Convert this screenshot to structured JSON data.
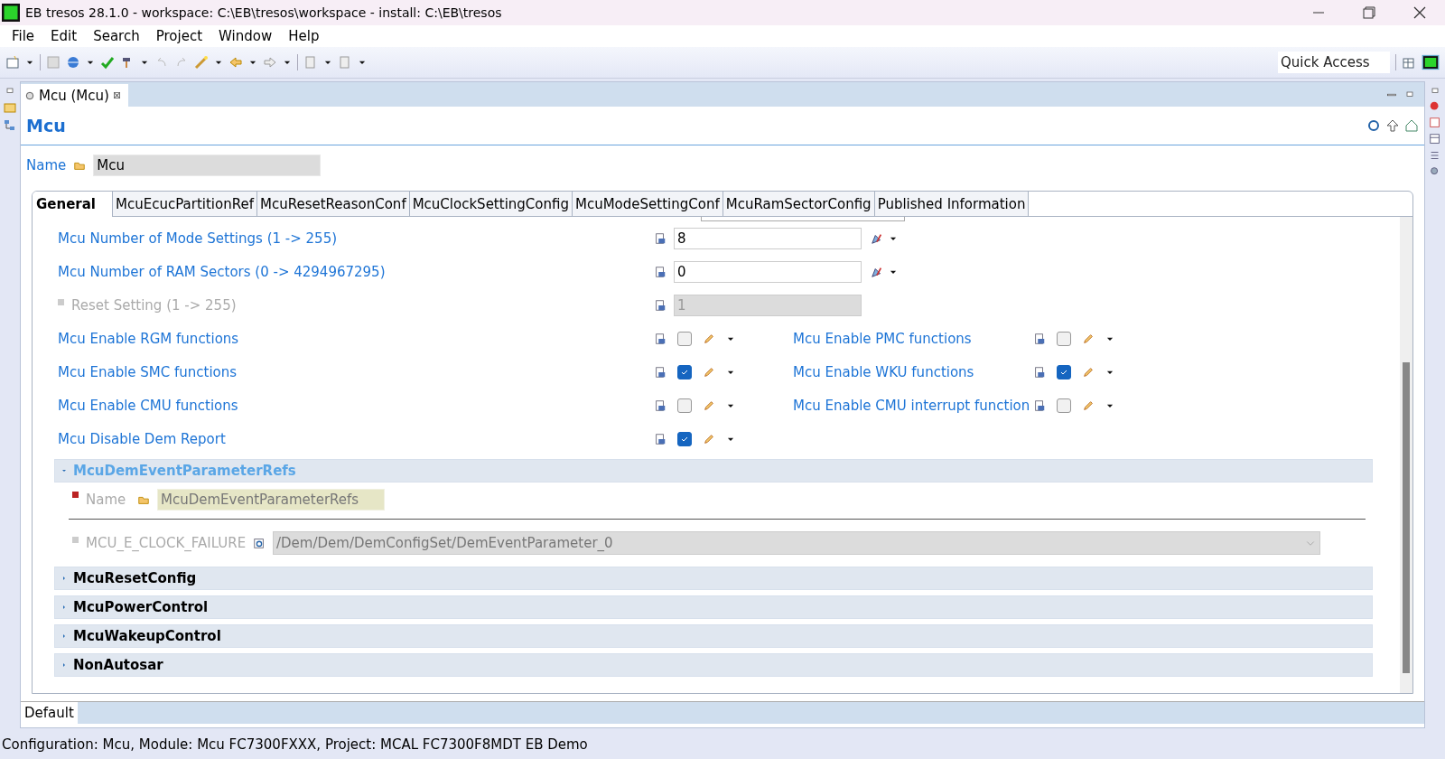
{
  "window": {
    "title": "EB tresos 28.1.0 - workspace: C:\\EB\\tresos\\workspace - install: C:\\EB\\tresos"
  },
  "menu": [
    "File",
    "Edit",
    "Search",
    "Project",
    "Window",
    "Help"
  ],
  "quick_access": {
    "placeholder": "Quick Access"
  },
  "editor_tab": {
    "label": "Mcu (Mcu)",
    "close": "⊠"
  },
  "form": {
    "title": "Mcu",
    "name_label": "Name",
    "name_value": "Mcu"
  },
  "tabs": [
    {
      "label": "General",
      "selected": true
    },
    {
      "label": "McuEcucPartitionRef",
      "selected": false
    },
    {
      "label": "McuResetReasonConf",
      "selected": false
    },
    {
      "label": "McuClockSettingConfig",
      "selected": false
    },
    {
      "label": "McuModeSettingConf",
      "selected": false
    },
    {
      "label": "McuRamSectorConfig",
      "selected": false
    },
    {
      "label": "Published Information",
      "selected": false
    }
  ],
  "number_settings": [
    {
      "label": "Mcu Number of Mode Settings (1 -> 255)",
      "value": "8",
      "disabled": false
    },
    {
      "label": "Mcu Number of RAM Sectors (0 -> 4294967295)",
      "value": "0",
      "disabled": false
    },
    {
      "label": "Reset Setting (1 -> 255)",
      "value": "1",
      "disabled": true
    }
  ],
  "checkbox_rows": [
    {
      "left": {
        "label": "Mcu Enable RGM functions",
        "checked": false
      },
      "right": {
        "label": "Mcu Enable PMC functions",
        "checked": false
      }
    },
    {
      "left": {
        "label": "Mcu Enable SMC functions",
        "checked": true
      },
      "right": {
        "label": "Mcu Enable WKU functions",
        "checked": true
      }
    },
    {
      "left": {
        "label": "Mcu Enable CMU functions",
        "checked": false
      },
      "right": {
        "label": "Mcu Enable CMU interrupt function",
        "checked": false
      }
    },
    {
      "left": {
        "label": "Mcu Disable Dem Report",
        "checked": true
      }
    }
  ],
  "sections": [
    {
      "title": "McuDemEventParameterRefs",
      "expanded": true,
      "name_label": "Name",
      "name_value": "McuDemEventParameterRefs",
      "ref_label": "MCU_E_CLOCK_FAILURE",
      "ref_value": "/Dem/Dem/DemConfigSet/DemEventParameter_0"
    },
    {
      "title": "McuResetConfig",
      "expanded": false
    },
    {
      "title": "McuPowerControl",
      "expanded": false
    },
    {
      "title": "McuWakeupControl",
      "expanded": false
    },
    {
      "title": "NonAutosar",
      "expanded": false
    }
  ],
  "bottom_tab": {
    "label": "Default"
  },
  "status_bar": "Configuration: Mcu, Module: Mcu FC7300FXXX, Project: MCAL FC7300F8MDT EB Demo"
}
